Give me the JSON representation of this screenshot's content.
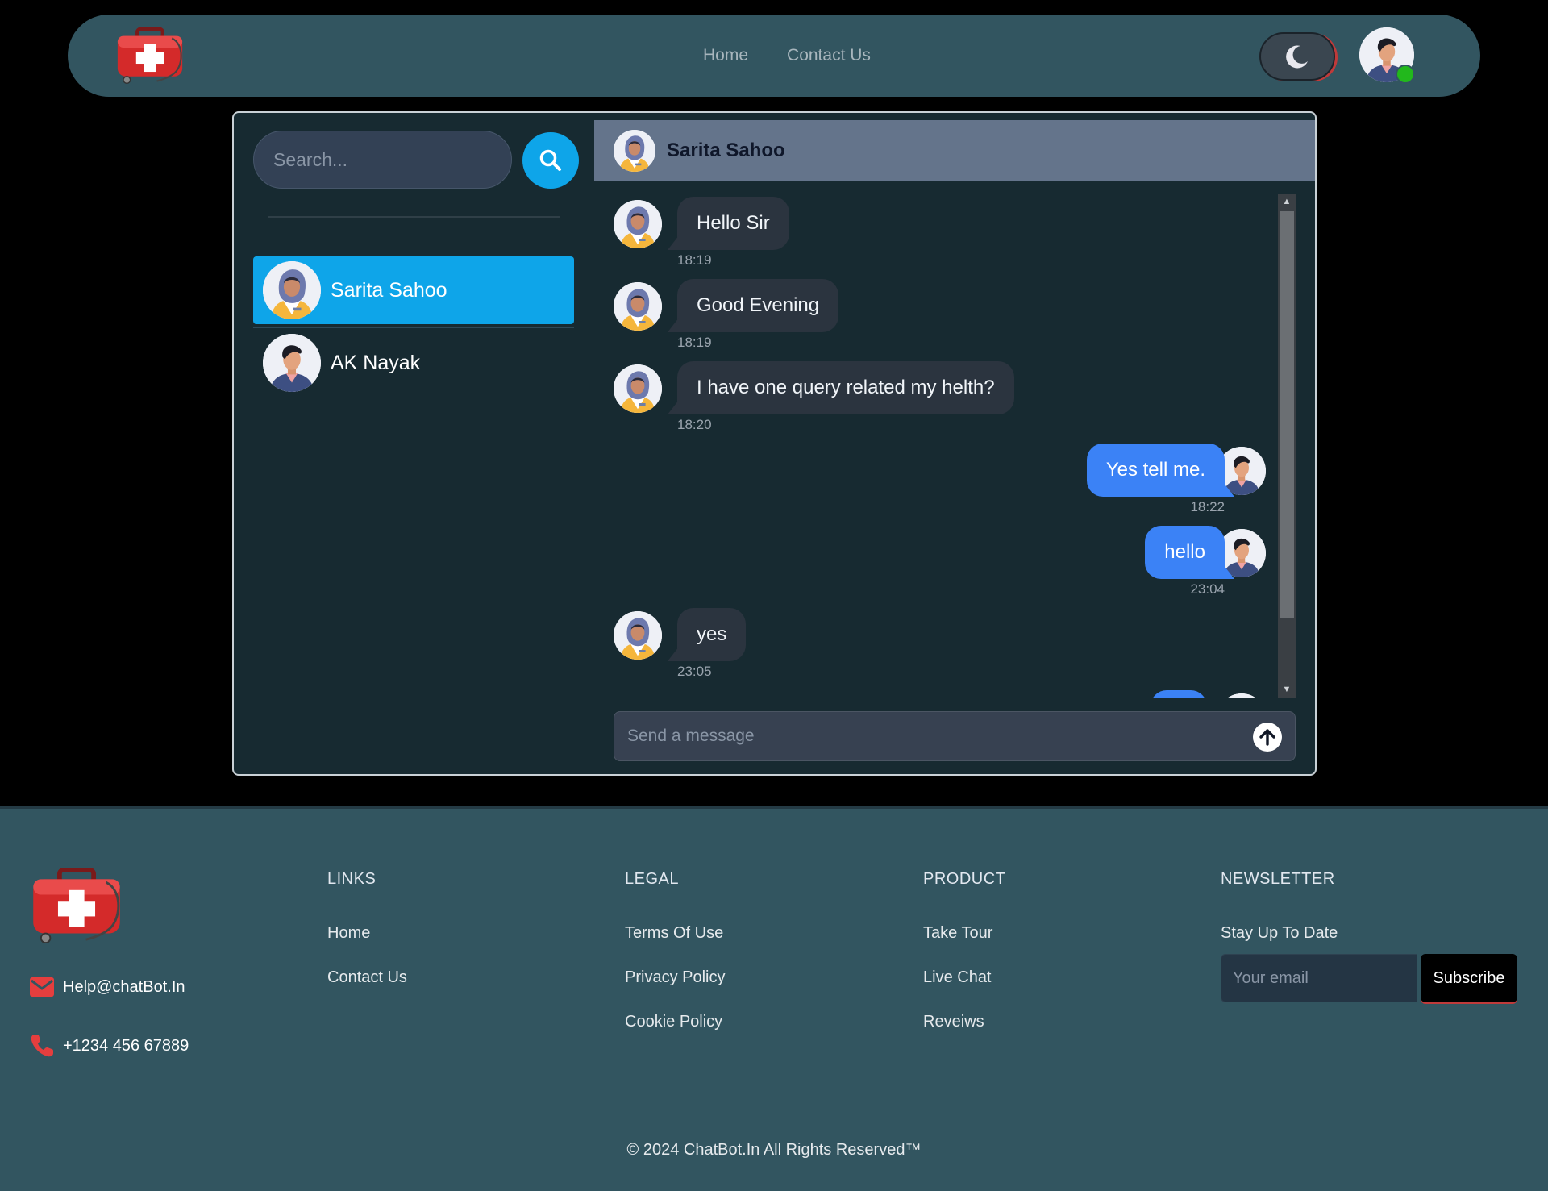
{
  "nav": {
    "links": [
      "Home",
      "Contact Us"
    ]
  },
  "search": {
    "placeholder": "Search..."
  },
  "contacts": [
    {
      "name": "Sarita Sahoo",
      "active": true
    },
    {
      "name": "AK Nayak",
      "active": false
    }
  ],
  "chat": {
    "header_name": "Sarita Sahoo",
    "messages": [
      {
        "direction": "in",
        "text": "Hello Sir",
        "time": "18:19"
      },
      {
        "direction": "in",
        "text": "Good Evening",
        "time": "18:19"
      },
      {
        "direction": "in",
        "text": "I have one query related my helth?",
        "time": "18:20"
      },
      {
        "direction": "out",
        "text": "Yes tell me.",
        "time": "18:22"
      },
      {
        "direction": "out",
        "text": "hello",
        "time": "23:04"
      },
      {
        "direction": "in",
        "text": "yes",
        "time": "23:05"
      }
    ],
    "composer_placeholder": "Send a message"
  },
  "footer": {
    "email": "Help@chatBot.In",
    "phone": "+1234 456 67889",
    "links_heading": "LINKS",
    "links": [
      "Home",
      "Contact Us"
    ],
    "legal_heading": "LEGAL",
    "legal": [
      "Terms Of Use",
      "Privacy Policy",
      "Cookie Policy"
    ],
    "product_heading": "PRODUCT",
    "product": [
      "Take Tour",
      "Live Chat",
      "Reveiws"
    ],
    "newsletter_heading": "NEWSLETTER",
    "newsletter_text": "Stay Up To Date",
    "email_placeholder": "Your email",
    "subscribe_label": "Subscribe",
    "copyright": "© 2024 ChatBot.In All Rights Reserved™"
  },
  "colors": {
    "nav_bg": "#325560",
    "accent_blue": "#0ea5e9",
    "outgoing_bubble": "#3b82f6",
    "incoming_bubble": "#2b343f",
    "online": "#22b81c"
  }
}
